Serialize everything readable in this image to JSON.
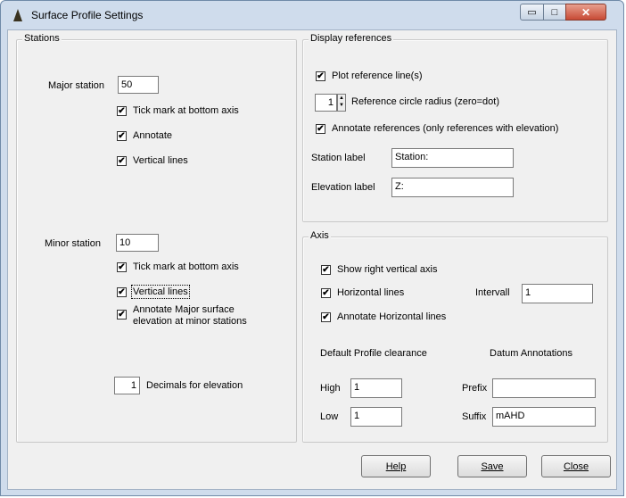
{
  "window": {
    "title": "Surface Profile Settings"
  },
  "caption_buttons": {
    "minimize": "▭",
    "maximize": "□",
    "close": "✕"
  },
  "stations": {
    "legend": "Stations",
    "major": {
      "label": "Major station",
      "value": "50",
      "tick_mark": {
        "label": "Tick mark at bottom axis",
        "checked": true
      },
      "annotate": {
        "label": "Annotate",
        "checked": true
      },
      "vertical_lines": {
        "label": "Vertical lines",
        "checked": true
      }
    },
    "minor": {
      "label": "Minor station",
      "value": "10",
      "tick_mark": {
        "label": "Tick mark at bottom axis",
        "checked": true
      },
      "vertical_lines": {
        "label": "Vertical lines",
        "checked": true
      },
      "annotate_major_line1": "Annotate Major surface",
      "annotate_major_line2": "elevation at minor stations",
      "annotate_major_checked": true
    },
    "decimals": {
      "value": "1",
      "label": "Decimals for elevation"
    }
  },
  "display_references": {
    "legend": "Display references",
    "plot_reference": {
      "label": "Plot reference line(s)",
      "checked": true
    },
    "radius": {
      "value": "1",
      "label": "Reference circle radius (zero=dot)"
    },
    "annotate_references": {
      "label": "Annotate references (only references with elevation)",
      "checked": true
    },
    "station_label": {
      "label": "Station label",
      "value": "Station:"
    },
    "elevation_label": {
      "label": "Elevation label",
      "value": "Z:"
    }
  },
  "axis": {
    "legend": "Axis",
    "show_right": {
      "label": "Show right vertical axis",
      "checked": true
    },
    "horizontal_lines": {
      "label": "Horizontal lines",
      "checked": true
    },
    "interval": {
      "label": "Intervall",
      "value": "1"
    },
    "annotate_horizontal": {
      "label": "Annotate Horizontal lines",
      "checked": true
    },
    "clearance": {
      "heading": "Default Profile clearance",
      "high_label": "High",
      "high_value": "1",
      "low_label": "Low",
      "low_value": "1"
    },
    "datum": {
      "heading": "Datum Annotations",
      "prefix_label": "Prefix",
      "prefix_value": "",
      "suffix_label": "Suffix",
      "suffix_value": "mAHD"
    }
  },
  "buttons": {
    "help": "Help",
    "save": "Save",
    "close": "Close"
  },
  "check_glyph": "✔"
}
